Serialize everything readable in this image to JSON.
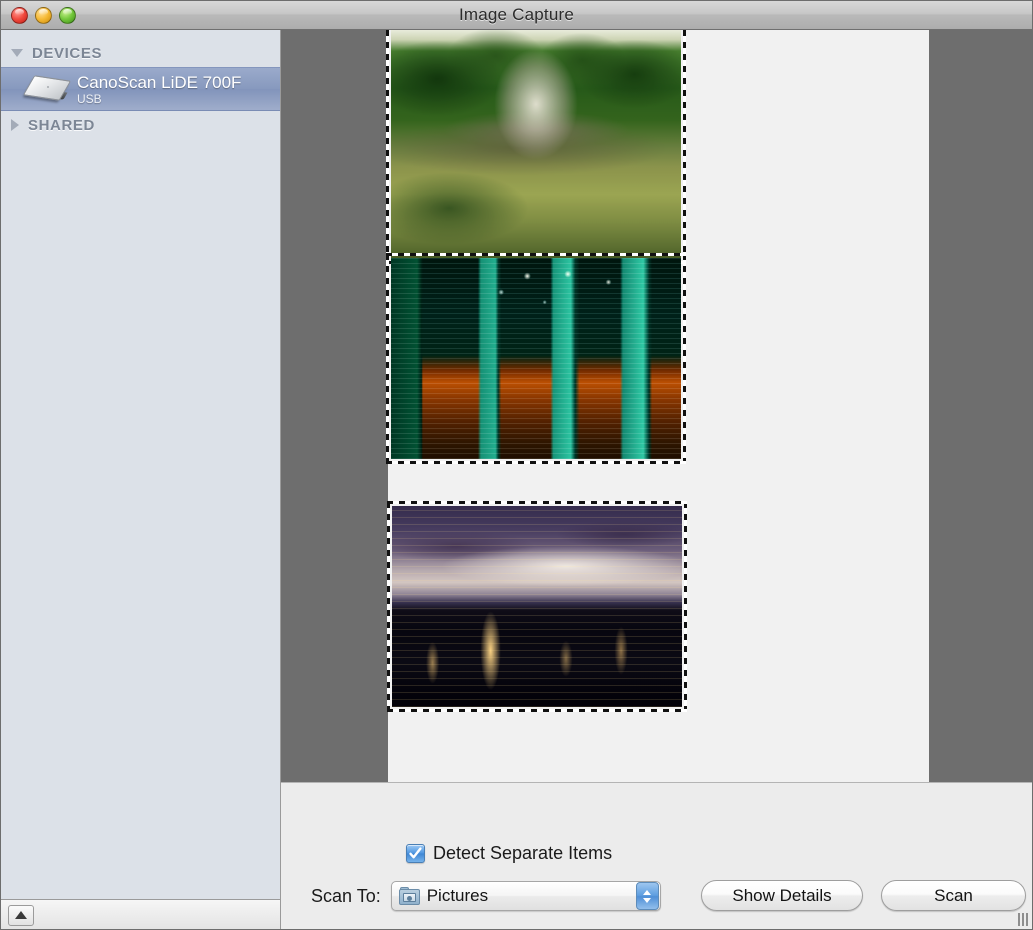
{
  "window": {
    "title": "Image Capture",
    "controls": [
      {
        "name": "close",
        "label": "Close"
      },
      {
        "name": "minimize",
        "label": "Minimize"
      },
      {
        "name": "zoom",
        "label": "Zoom"
      }
    ]
  },
  "sidebar": {
    "groups": [
      {
        "label": "DEVICES",
        "expanded": true,
        "disclosure": "triangle-down-icon",
        "items": [
          {
            "name": "CanoScan LiDE 700F",
            "subtitle": "USB",
            "icon": "scanner-icon",
            "selected": true
          }
        ]
      },
      {
        "label": "SHARED",
        "expanded": false,
        "disclosure": "triangle-right-icon",
        "items": []
      }
    ],
    "status_bar": {
      "eject_button_icon": "eject-icon"
    }
  },
  "scan_preview": {
    "background_color": "#6e6e6e",
    "page_color": "#f1f1f1",
    "detected_items": [
      {
        "index": 1,
        "description": "Japanese garden pond with stone pagoda",
        "selected": true
      },
      {
        "index": 2,
        "description": "Night cityscape with teal apartment towers",
        "selected": true
      },
      {
        "index": 3,
        "description": "Dusk skyline with purple storm clouds",
        "selected": true
      }
    ]
  },
  "controls": {
    "detect_separate_items": {
      "label": "Detect Separate Items",
      "checked": true
    },
    "scan_to": {
      "label": "Scan To:",
      "value": "Pictures",
      "icon": "pictures-folder-icon",
      "options": [
        "Pictures"
      ]
    },
    "show_details_button": "Show Details",
    "scan_button": "Scan"
  },
  "colors": {
    "sidebar_background": "#dce1e8",
    "selection_blue": "#8799be",
    "panel_background": "#ececec",
    "accent_checkbox": "#4f96e0"
  }
}
